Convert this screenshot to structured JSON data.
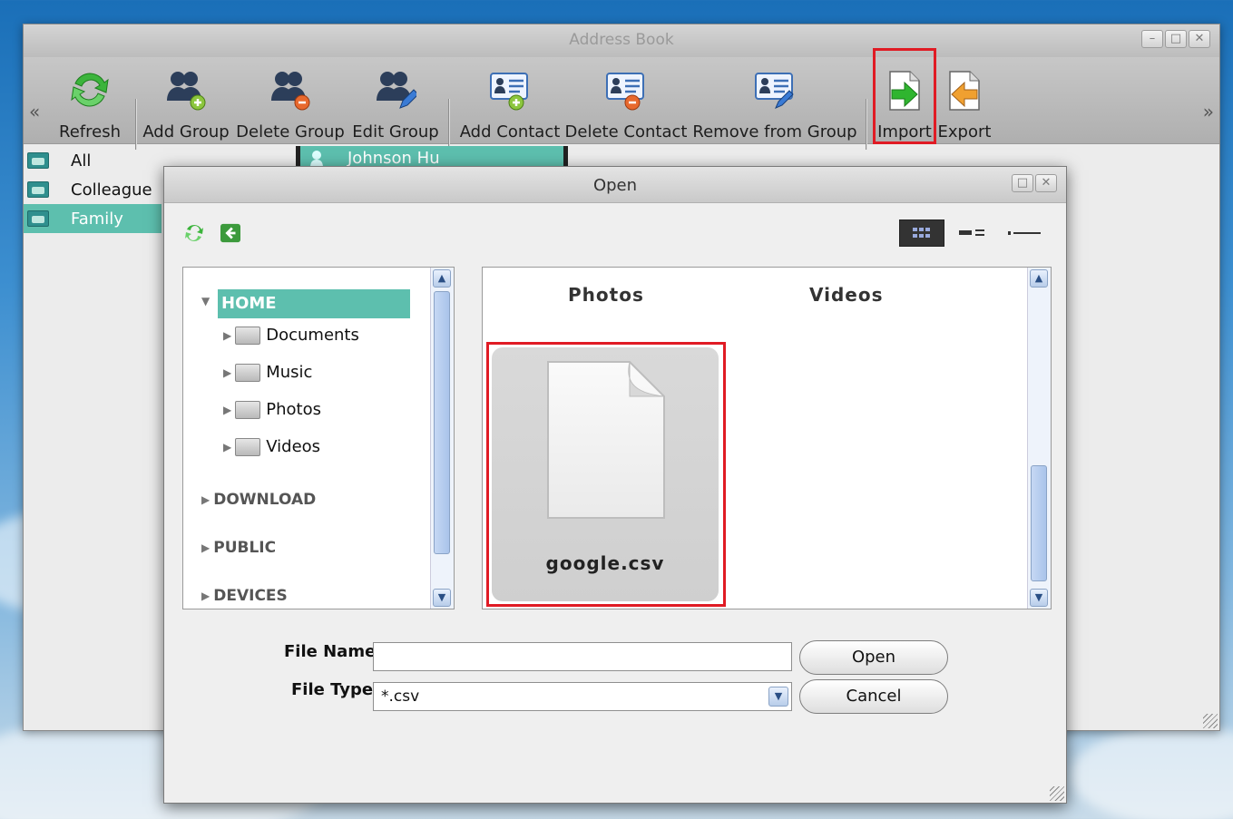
{
  "app": {
    "title": "Address Book",
    "window_buttons": [
      "–",
      "□",
      "✕"
    ],
    "nav_left": "«",
    "nav_right": "»"
  },
  "toolbar": {
    "items": [
      {
        "label": "Refresh",
        "icon": "refresh-icon"
      },
      {
        "label": "Add Group",
        "icon": "add-group-icon"
      },
      {
        "label": "Delete Group",
        "icon": "delete-group-icon"
      },
      {
        "label": "Edit Group",
        "icon": "edit-group-icon"
      },
      {
        "label": "Add Contact",
        "icon": "add-contact-icon"
      },
      {
        "label": "Delete Contact",
        "icon": "delete-contact-icon"
      },
      {
        "label": "Remove from Group",
        "icon": "remove-from-group-icon"
      },
      {
        "label": "Import",
        "icon": "import-icon"
      },
      {
        "label": "Export",
        "icon": "export-icon"
      }
    ]
  },
  "groups": [
    {
      "label": "All"
    },
    {
      "label": "Colleague"
    },
    {
      "label": "Family"
    }
  ],
  "contact": {
    "name": "Johnson Hu"
  },
  "dialog": {
    "title": "Open",
    "tree": {
      "home": "HOME",
      "children": [
        "Documents",
        "Music",
        "Photos",
        "Videos"
      ],
      "roots": [
        "DOWNLOAD",
        "PUBLIC",
        "DEVICES"
      ]
    },
    "files": {
      "folders": [
        "Photos",
        "Videos"
      ],
      "selected_file": "google.csv"
    },
    "file_name_label": "File Name",
    "file_name_value": "",
    "file_type_label": "File Type",
    "file_type_value": "*.csv",
    "open_button": "Open",
    "cancel_button": "Cancel"
  },
  "colors": {
    "accent": "#5dbfae",
    "highlight": "#e01b24"
  }
}
